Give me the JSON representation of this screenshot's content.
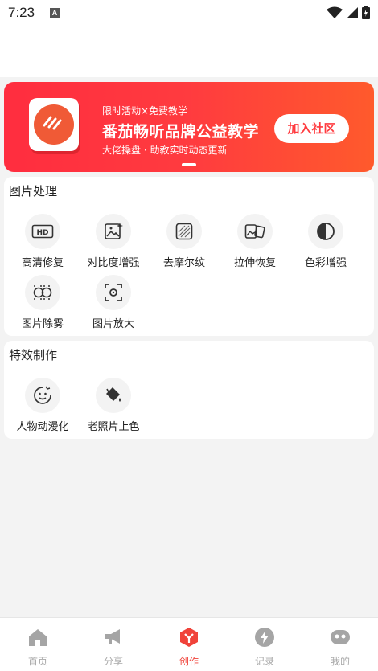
{
  "status_bar": {
    "time": "7:23",
    "notification_icon": "A"
  },
  "banner": {
    "subtitle": "限时活动×免费教学",
    "title": "番茄畅听品牌公益教学",
    "description": "大佬操盘 · 助教实时动态更新",
    "join_button": "加入社区"
  },
  "image_processing": {
    "title": "图片处理",
    "tools": [
      {
        "label": "高清修复",
        "icon": "hd-icon"
      },
      {
        "label": "对比度增强",
        "icon": "image-sparkle-icon"
      },
      {
        "label": "去摩尔纹",
        "icon": "moire-pattern-icon"
      },
      {
        "label": "拉伸恢复",
        "icon": "stretch-image-icon"
      },
      {
        "label": "色彩增强",
        "icon": "contrast-circle-icon"
      },
      {
        "label": "图片除雾",
        "icon": "dehaze-icon"
      },
      {
        "label": "图片放大",
        "icon": "zoom-frame-icon"
      }
    ]
  },
  "effects": {
    "title": "特效制作",
    "tools": [
      {
        "label": "人物动漫化",
        "icon": "cartoon-face-icon"
      },
      {
        "label": "老照片上色",
        "icon": "paint-bucket-icon"
      }
    ]
  },
  "tabbar": {
    "tabs": [
      {
        "label": "首页",
        "icon": "home-icon"
      },
      {
        "label": "分享",
        "icon": "megaphone-icon"
      },
      {
        "label": "创作",
        "icon": "create-icon"
      },
      {
        "label": "记录",
        "icon": "lightning-icon"
      },
      {
        "label": "我的",
        "icon": "profile-icon"
      }
    ],
    "active_index": 2
  },
  "colors": {
    "accent": "#f0433a",
    "banner_start": "#ff2d3f",
    "banner_end": "#ff5a2c"
  }
}
